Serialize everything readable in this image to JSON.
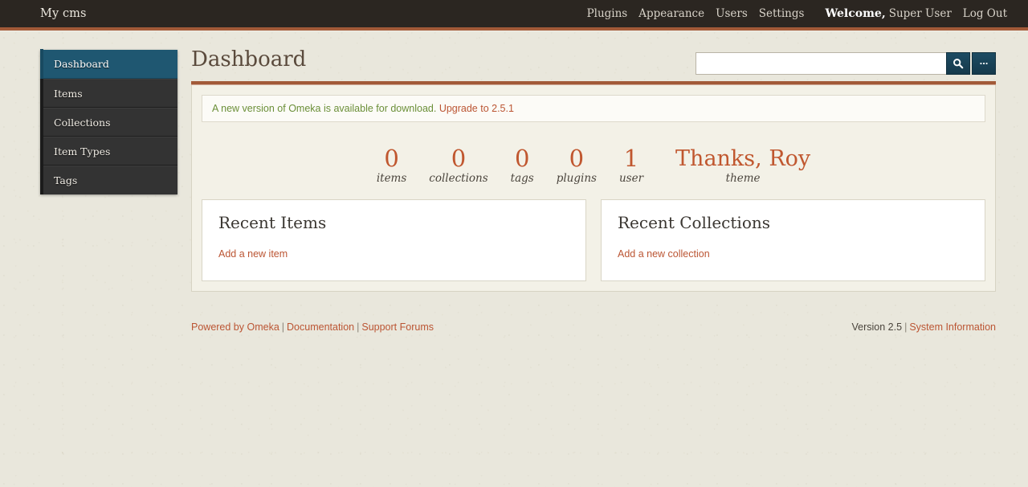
{
  "topbar": {
    "site_title": "My cms",
    "nav": [
      {
        "label": "Plugins",
        "name": "plugins"
      },
      {
        "label": "Appearance",
        "name": "appearance"
      },
      {
        "label": "Users",
        "name": "users"
      },
      {
        "label": "Settings",
        "name": "settings"
      }
    ],
    "welcome_label": "Welcome,",
    "welcome_user": "Super User",
    "logout_label": "Log Out"
  },
  "sidebar": {
    "items": [
      {
        "label": "Dashboard",
        "name": "dashboard",
        "active": true
      },
      {
        "label": "Items",
        "name": "items",
        "active": false
      },
      {
        "label": "Collections",
        "name": "collections",
        "active": false
      },
      {
        "label": "Item Types",
        "name": "item-types",
        "active": false
      },
      {
        "label": "Tags",
        "name": "tags",
        "active": false
      }
    ]
  },
  "main": {
    "page_title": "Dashboard",
    "search": {
      "value": "",
      "placeholder": "",
      "search_icon": "search-icon",
      "options_label": "..."
    },
    "notice": {
      "text": "A new version of Omeka is available for download.",
      "link_label": "Upgrade to 2.5.1"
    },
    "stats": [
      {
        "value": "0",
        "label": "items",
        "name": "items"
      },
      {
        "value": "0",
        "label": "collections",
        "name": "collections"
      },
      {
        "value": "0",
        "label": "tags",
        "name": "tags"
      },
      {
        "value": "0",
        "label": "plugins",
        "name": "plugins"
      },
      {
        "value": "1",
        "label": "user",
        "name": "user"
      },
      {
        "value": "Thanks, Roy",
        "label": "theme",
        "name": "theme"
      }
    ],
    "recent_items": {
      "heading": "Recent Items",
      "add_link": "Add a new item"
    },
    "recent_collections": {
      "heading": "Recent Collections",
      "add_link": "Add a new collection"
    }
  },
  "footer": {
    "powered_by": "Powered by Omeka",
    "documentation": "Documentation",
    "support_forums": "Support Forums",
    "version": "Version 2.5",
    "system_information": "System Information",
    "separator": "|"
  },
  "colors": {
    "header_bg": "#2b2621",
    "accent_rust": "#a25a38",
    "link_orange": "#bb5533",
    "stat_orange": "#c0572f",
    "notice_green": "#6b8f38",
    "active_nav_teal": "#1f5771",
    "page_bg": "#e9e7dc"
  }
}
